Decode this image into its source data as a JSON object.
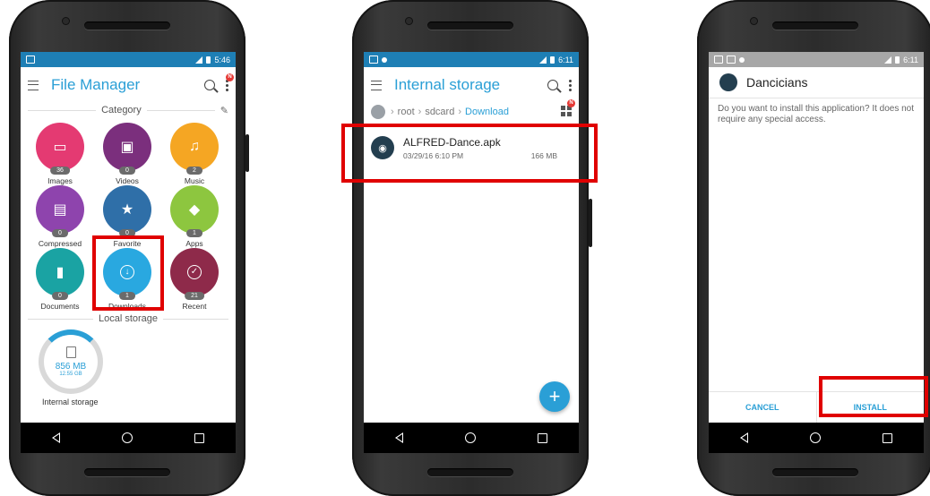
{
  "colors": {
    "accent": "#2a9fd6",
    "status_bar": "#1e7fb5",
    "highlight": "#e00000",
    "images": "#e43a72",
    "videos": "#7b2f7d",
    "music": "#f5a623",
    "compressed": "#8e44ad",
    "favorite": "#2f6fa8",
    "apps": "#8dc63f",
    "documents": "#1aa3a3",
    "downloads": "#29a8e0",
    "recent": "#8e2a4a"
  },
  "phone1": {
    "status_time": "5:46",
    "title": "File Manager",
    "category_header": "Category",
    "categories": [
      {
        "label": "Images",
        "count": "36",
        "icon": "image-icon"
      },
      {
        "label": "Videos",
        "count": "0",
        "icon": "film-icon"
      },
      {
        "label": "Music",
        "count": "2",
        "icon": "music-note-icon"
      },
      {
        "label": "Compressed",
        "count": "0",
        "icon": "zip-icon"
      },
      {
        "label": "Favorite",
        "count": "0",
        "icon": "star-icon"
      },
      {
        "label": "Apps",
        "count": "1",
        "icon": "android-icon"
      },
      {
        "label": "Documents",
        "count": "0",
        "icon": "document-icon"
      },
      {
        "label": "Downloads",
        "count": "1",
        "icon": "download-icon"
      },
      {
        "label": "Recent",
        "count": "21",
        "icon": "check-circle-icon"
      }
    ],
    "local_storage_header": "Local storage",
    "storage_used": "856 MB",
    "storage_total": "12.55 GB",
    "storage_label": "Internal storage",
    "notification_badge": "N"
  },
  "phone2": {
    "status_time": "6:11",
    "title": "Internal storage",
    "crumbs": [
      "root",
      "sdcard",
      "Download"
    ],
    "file": {
      "name": "ALFRED-Dance.apk",
      "date": "03/29/16 6:10 PM",
      "size": "166 MB"
    },
    "fab_label": "+",
    "notification_badge": "N"
  },
  "phone3": {
    "status_time": "6:11",
    "app_name": "Dancicians",
    "message": "Do you want to install this application? It does not require any special access.",
    "cancel_label": "CANCEL",
    "install_label": "INSTALL"
  }
}
